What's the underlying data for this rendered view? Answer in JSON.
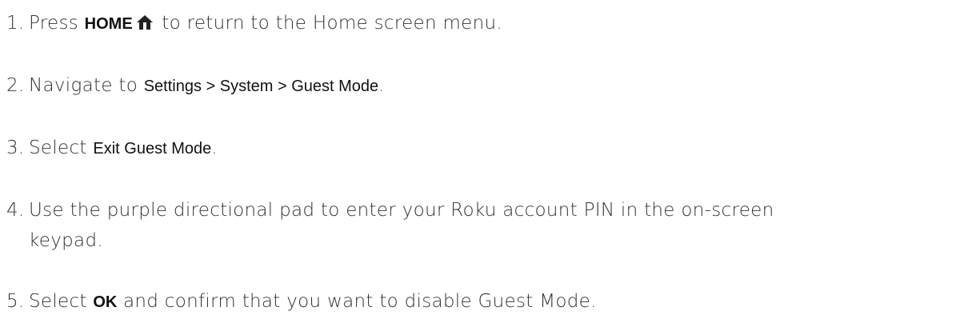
{
  "steps": [
    {
      "number": "1.",
      "text_before": "Press ",
      "keyword": "HOME",
      "icon": "home-icon",
      "text_after": " to return to the Home screen menu."
    },
    {
      "number": "2.",
      "text_before": "Navigate to ",
      "keyword": "Settings > System > Guest Mode",
      "text_after": "."
    },
    {
      "number": "3.",
      "text_before": "Select ",
      "keyword": "Exit Guest Mode",
      "text_after": "."
    },
    {
      "number": "4.",
      "line1": "Use the purple directional pad to enter your Roku account PIN in the on-screen",
      "line2": "keypad."
    },
    {
      "number": "5.",
      "text_before": "Select ",
      "keyword": "OK",
      "text_after": " and confirm that you want to disable Guest Mode."
    }
  ]
}
